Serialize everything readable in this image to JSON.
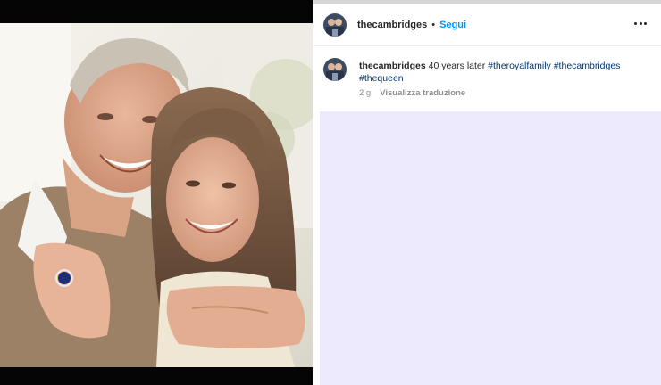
{
  "post": {
    "username": "thecambridges",
    "separator": "•",
    "follow_label": "Segui",
    "more_icon": "more-horizontal-icon",
    "caption": {
      "username": "thecambridges",
      "text": "40 years later",
      "hashtags": [
        "#theroyalfamily",
        "#thecambridges",
        "#thequeen"
      ]
    },
    "time_ago": "2 g",
    "translate_label": "Visualizza traduzione"
  },
  "photo": {
    "description_icon": "photo-image"
  },
  "colors": {
    "accent": "#0095f6",
    "hashtag": "#00376b",
    "muted": "#8e8e8e",
    "text": "#262626",
    "lower_background": "#eceafc"
  }
}
